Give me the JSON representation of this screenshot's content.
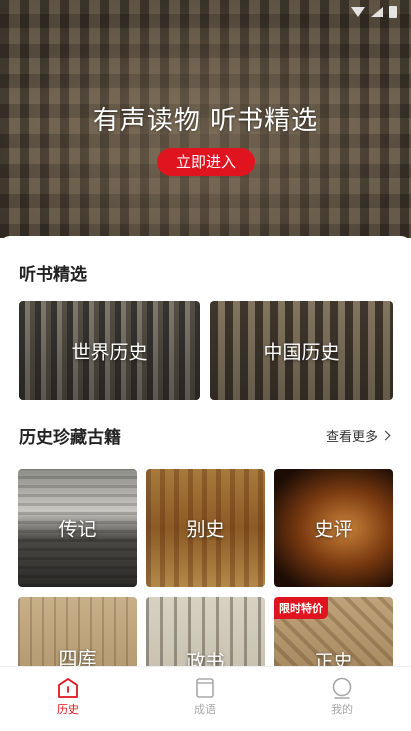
{
  "hero": {
    "title": "有声读物 听书精选",
    "button": "立即进入"
  },
  "audio_section": {
    "title": "听书精选",
    "cards": [
      {
        "label": "世界历史"
      },
      {
        "label": "中国历史"
      }
    ]
  },
  "books_section": {
    "title": "历史珍藏古籍",
    "more": "查看更多",
    "cards": [
      {
        "label": "传记"
      },
      {
        "label": "别史"
      },
      {
        "label": "史评"
      },
      {
        "label": "四库"
      },
      {
        "label": "政书"
      },
      {
        "label": "正史",
        "badge": "限时特价"
      }
    ]
  },
  "tabbar": {
    "tabs": [
      {
        "label": "历史",
        "active": true,
        "icon": "history-icon"
      },
      {
        "label": "成语",
        "active": false,
        "icon": "book-icon"
      },
      {
        "label": "我的",
        "active": false,
        "icon": "profile-icon"
      }
    ]
  },
  "colors": {
    "accent": "#e0141e",
    "inactive": "#a8a8a8"
  }
}
